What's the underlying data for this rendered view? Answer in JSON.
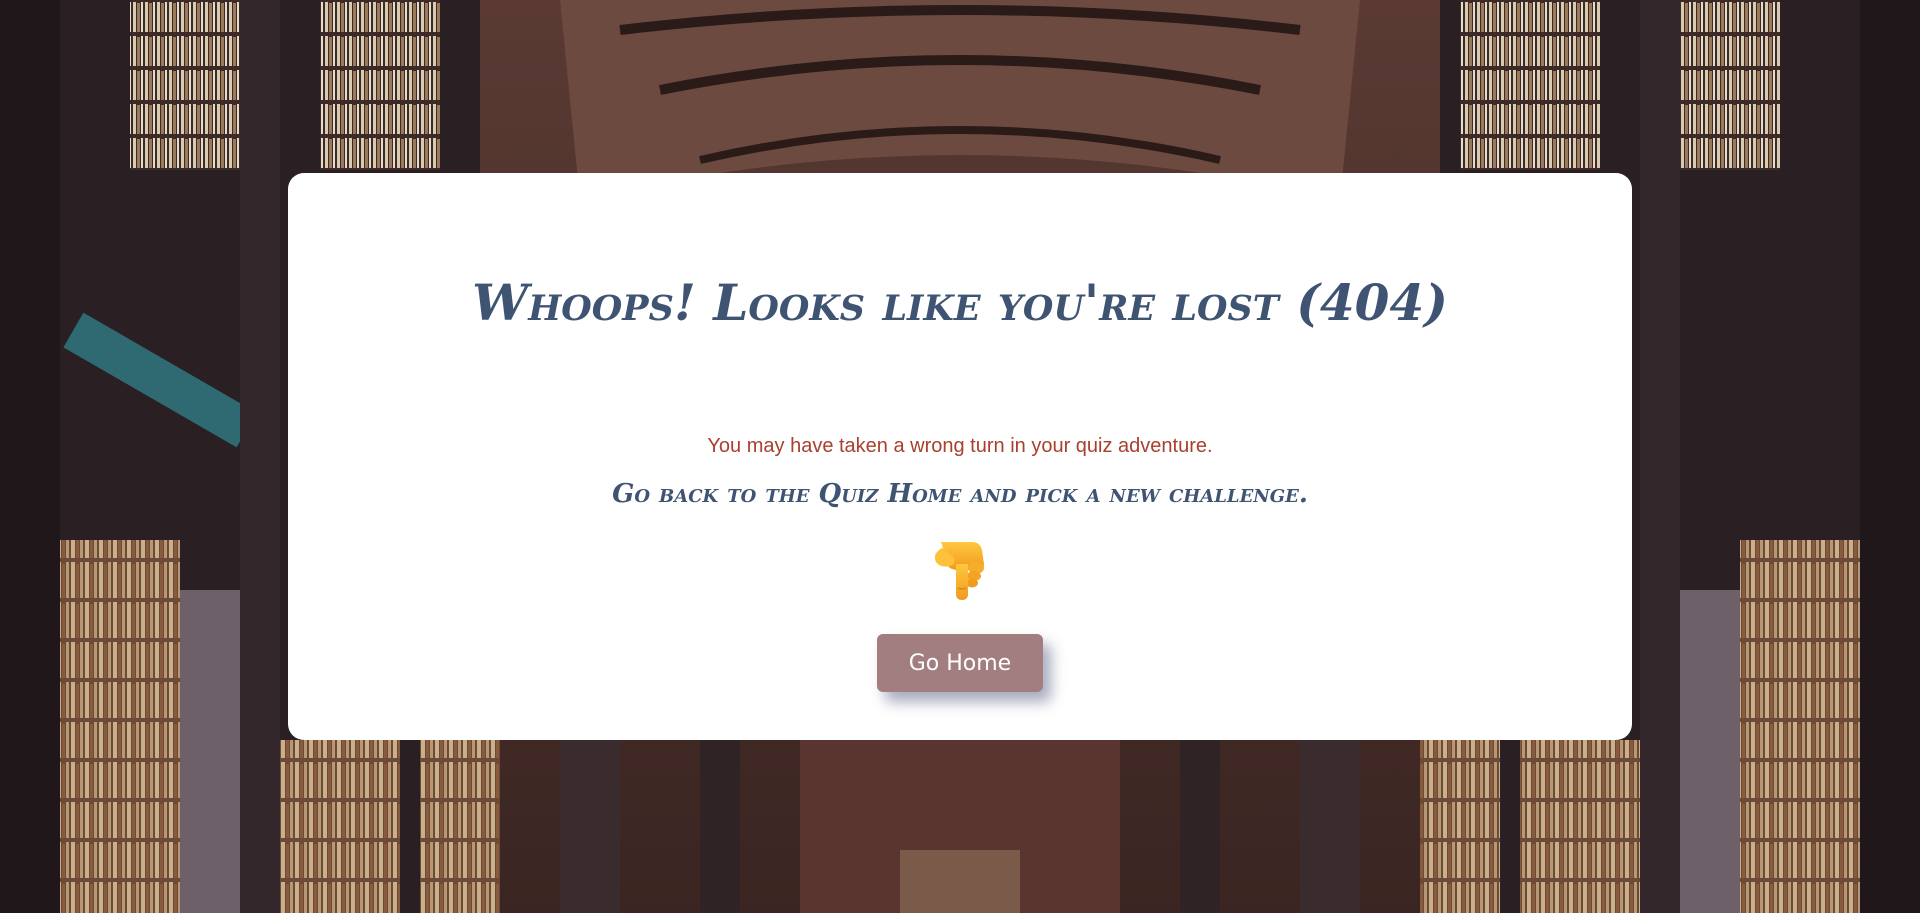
{
  "page": {
    "heading": "Whoops! Looks like you're lost (404)",
    "message": "You may have taken a wrong turn in your quiz adventure.",
    "instruction": "Go back to the Quiz Home and pick a new challenge.",
    "pointer_icon": "backhand-index-pointing-down-icon",
    "home_button_label": "Go Home"
  },
  "colors": {
    "heading": "#3f5473",
    "message": "#a8402e",
    "button_bg": "#a37e80",
    "card_bg": "#ffffff"
  }
}
